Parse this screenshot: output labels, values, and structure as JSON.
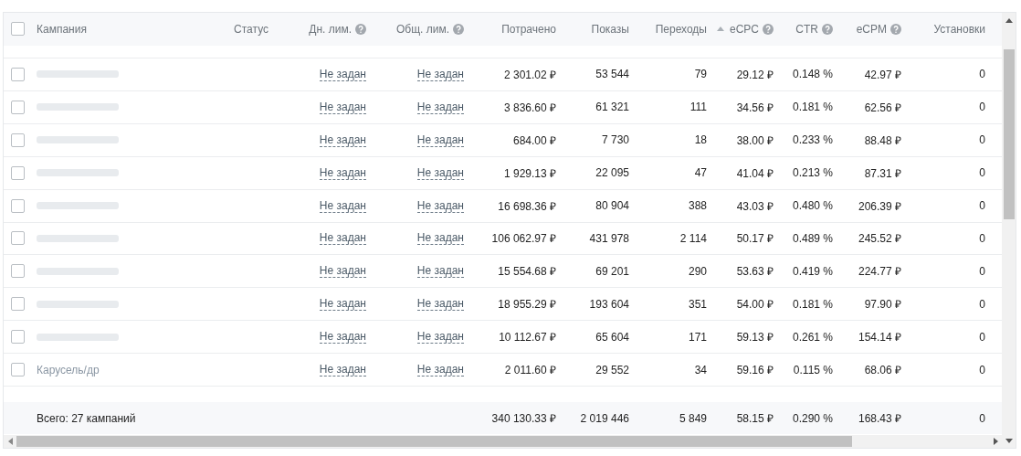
{
  "table": {
    "header_checkbox": {
      "checked": false
    },
    "columns": [
      {
        "label": "Кампания",
        "help": false,
        "sorted": false
      },
      {
        "label": "Статус",
        "help": false,
        "sorted": false
      },
      {
        "label": "Дн. лим.",
        "help": true,
        "sorted": false
      },
      {
        "label": "Общ. лим.",
        "help": true,
        "sorted": false
      },
      {
        "label": "Потрачено",
        "help": false,
        "sorted": false
      },
      {
        "label": "Показы",
        "help": false,
        "sorted": false
      },
      {
        "label": "Переходы",
        "help": false,
        "sorted": false
      },
      {
        "label": "eCPC",
        "help": true,
        "sorted": true
      },
      {
        "label": "CTR",
        "help": true,
        "sorted": false
      },
      {
        "label": "eCPM",
        "help": true,
        "sorted": false
      },
      {
        "label": "Установки",
        "help": false,
        "sorted": false
      }
    ],
    "rows": [
      {
        "checked": false,
        "name_hidden": true,
        "cells": [
          "",
          "",
          "Не задан",
          "Не задан",
          "2 301.02 ₽",
          "53 544",
          "79",
          "29.12 ₽",
          "0.148 %",
          "42.97 ₽",
          "0"
        ]
      },
      {
        "checked": false,
        "name_hidden": true,
        "cells": [
          "",
          "",
          "Не задан",
          "Не задан",
          "3 836.60 ₽",
          "61 321",
          "111",
          "34.56 ₽",
          "0.181 %",
          "62.56 ₽",
          "0"
        ]
      },
      {
        "checked": false,
        "name_hidden": true,
        "cells": [
          "",
          "",
          "Не задан",
          "Не задан",
          "684.00 ₽",
          "7 730",
          "18",
          "38.00 ₽",
          "0.233 %",
          "88.48 ₽",
          "0"
        ]
      },
      {
        "checked": false,
        "name_hidden": true,
        "cells": [
          "",
          "",
          "Не задан",
          "Не задан",
          "1 929.13 ₽",
          "22 095",
          "47",
          "41.04 ₽",
          "0.213 %",
          "87.31 ₽",
          "0"
        ]
      },
      {
        "checked": false,
        "name_hidden": true,
        "cells": [
          "",
          "",
          "Не задан",
          "Не задан",
          "16 698.36 ₽",
          "80 904",
          "388",
          "43.03 ₽",
          "0.480 %",
          "206.39 ₽",
          "0"
        ]
      },
      {
        "checked": false,
        "name_hidden": true,
        "cells": [
          "",
          "",
          "Не задан",
          "Не задан",
          "106 062.97 ₽",
          "431 978",
          "2 114",
          "50.17 ₽",
          "0.489 %",
          "245.52 ₽",
          "0"
        ]
      },
      {
        "checked": false,
        "name_hidden": true,
        "cells": [
          "",
          "",
          "Не задан",
          "Не задан",
          "15 554.68 ₽",
          "69 201",
          "290",
          "53.63 ₽",
          "0.419 %",
          "224.77 ₽",
          "0"
        ]
      },
      {
        "checked": false,
        "name_hidden": true,
        "cells": [
          "",
          "",
          "Не задан",
          "Не задан",
          "18 955.29 ₽",
          "193 604",
          "351",
          "54.00 ₽",
          "0.181 %",
          "97.90 ₽",
          "0"
        ]
      },
      {
        "checked": false,
        "name_hidden": true,
        "cells": [
          "",
          "",
          "Не задан",
          "Не задан",
          "10 112.67 ₽",
          "65 604",
          "171",
          "59.13 ₽",
          "0.261 %",
          "154.14 ₽",
          "0"
        ]
      },
      {
        "checked": false,
        "name_hidden": false,
        "cells": [
          "Карусель/др",
          "",
          "Не задан",
          "Не задан",
          "2 011.60 ₽",
          "29 552",
          "34",
          "59.16 ₽",
          "0.115 %",
          "68.06 ₽",
          "0"
        ]
      }
    ],
    "footer": {
      "label": "Всего: 27 кампаний",
      "cells": [
        "340 130.33 ₽",
        "2 019 446",
        "5 849",
        "58.15 ₽",
        "0.290 %",
        "168.43 ₽",
        "0"
      ]
    }
  }
}
